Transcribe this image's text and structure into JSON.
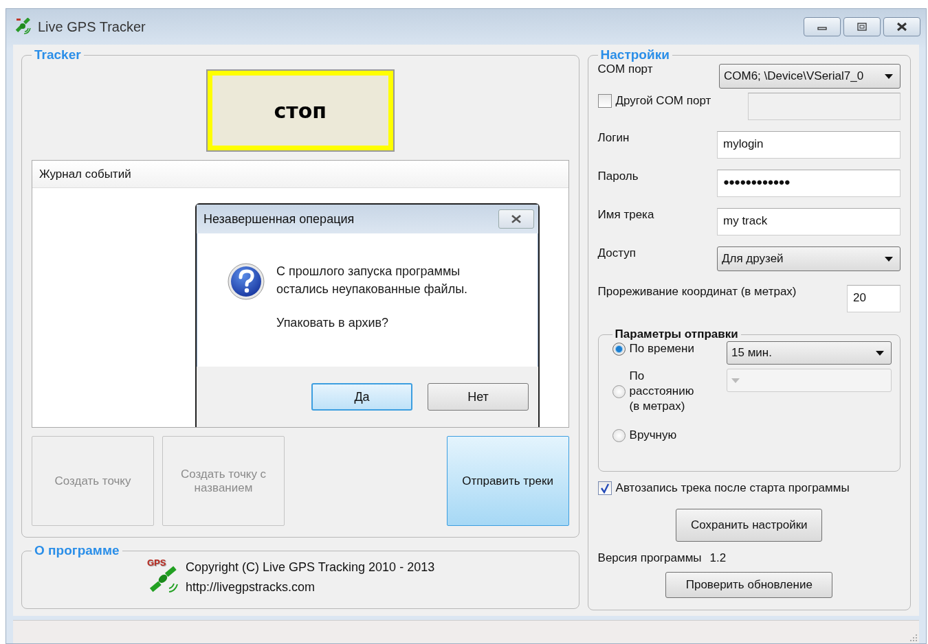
{
  "window": {
    "title": "Live GPS Tracker"
  },
  "tracker": {
    "legend": "Tracker",
    "stop_button": "стоп",
    "event_log": {
      "header": "Журнал событий"
    },
    "actions": [
      {
        "label": "Создать точку",
        "disabled": true,
        "highlighted": false
      },
      {
        "label": "Создать точку с названием",
        "disabled": true,
        "highlighted": false
      },
      {
        "label": "Отправить треки",
        "disabled": false,
        "highlighted": true
      }
    ]
  },
  "dialog": {
    "title": "Незавершенная операция",
    "message": "С прошлого запуска программы\nостались неупакованные файлы.",
    "question": "Упаковать в архив?",
    "buttons": [
      {
        "label": "Да",
        "default": true
      },
      {
        "label": "Нет",
        "default": false
      }
    ]
  },
  "about": {
    "legend": "О программе",
    "logo_text": "GPS",
    "copyright": "Copyright (C) Live GPS Tracking 2010 - 2013",
    "url": "http://livegpstracks.com"
  },
  "settings": {
    "legend": "Настройки",
    "com_port": {
      "label": "COM порт",
      "value": "COM6; \\Device\\VSerial7_0"
    },
    "other_com": {
      "label": "Другой COM порт",
      "checked": false
    },
    "login": {
      "label": "Логин",
      "value": "mylogin"
    },
    "password": {
      "label": "Пароль",
      "value": "●●●●●●●●●●●●"
    },
    "track_name": {
      "label": "Имя трека",
      "value": "my track"
    },
    "access": {
      "label": "Доступ",
      "value": "Для друзей"
    },
    "thinning": {
      "label": "Прореживание координат (в метрах)",
      "value": "20"
    },
    "send_params": {
      "legend": "Параметры отправки",
      "options": [
        {
          "label": "По времени",
          "selected": true,
          "dropdown": {
            "value": "15 мин.",
            "disabled": false
          }
        },
        {
          "label": "По расстоянию (в метрах)",
          "selected": false,
          "dropdown": {
            "disabled": true
          }
        },
        {
          "label": "Вручную",
          "selected": false
        }
      ]
    },
    "autostart": {
      "label": "Автозапись трека после старта программы",
      "checked": true
    },
    "save_button": "Сохранить настройки",
    "version": {
      "label": "Версия программы",
      "value": "1.2"
    },
    "update_button": "Проверить обновление"
  }
}
